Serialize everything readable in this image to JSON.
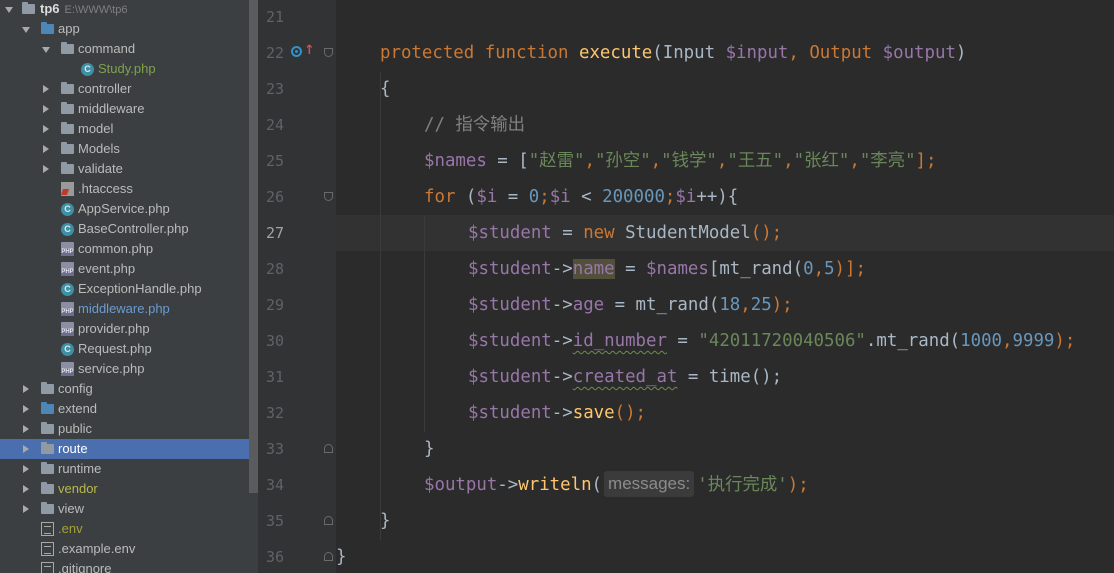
{
  "tree": {
    "project": {
      "name": "tp6",
      "path": "E:\\WWW\\tp6"
    },
    "items": [
      {
        "label": "app",
        "kind": "folder",
        "depth": 1,
        "state": "expanded",
        "color": "#4e86b6"
      },
      {
        "label": "command",
        "kind": "folder",
        "depth": 2,
        "state": "expanded"
      },
      {
        "label": "Study.php",
        "kind": "class-file",
        "depth": 3,
        "text_color": "#80a14f"
      },
      {
        "label": "controller",
        "kind": "folder",
        "depth": 2,
        "state": "collapsed"
      },
      {
        "label": "middleware",
        "kind": "folder",
        "depth": 2,
        "state": "collapsed"
      },
      {
        "label": "model",
        "kind": "folder",
        "depth": 2,
        "state": "collapsed"
      },
      {
        "label": "Models",
        "kind": "folder",
        "depth": 2,
        "state": "collapsed"
      },
      {
        "label": "validate",
        "kind": "folder",
        "depth": 2,
        "state": "collapsed"
      },
      {
        "label": ".htaccess",
        "kind": "htaccess-file",
        "depth": 2
      },
      {
        "label": "AppService.php",
        "kind": "class-file",
        "depth": 2
      },
      {
        "label": "BaseController.php",
        "kind": "class-file",
        "depth": 2
      },
      {
        "label": "common.php",
        "kind": "php-file",
        "depth": 2
      },
      {
        "label": "event.php",
        "kind": "php-file",
        "depth": 2
      },
      {
        "label": "ExceptionHandle.php",
        "kind": "class-file",
        "depth": 2
      },
      {
        "label": "middleware.php",
        "kind": "php-file",
        "depth": 2,
        "text_color": "#6b9bd2"
      },
      {
        "label": "provider.php",
        "kind": "php-file",
        "depth": 2
      },
      {
        "label": "Request.php",
        "kind": "class-file",
        "depth": 2
      },
      {
        "label": "service.php",
        "kind": "php-file",
        "depth": 2
      },
      {
        "label": "config",
        "kind": "folder",
        "depth": 1,
        "state": "collapsed"
      },
      {
        "label": "extend",
        "kind": "folder",
        "depth": 1,
        "state": "collapsed",
        "color": "#4e86b6"
      },
      {
        "label": "public",
        "kind": "folder",
        "depth": 1,
        "state": "collapsed"
      },
      {
        "label": "route",
        "kind": "folder",
        "depth": 1,
        "state": "collapsed",
        "selected": true
      },
      {
        "label": "runtime",
        "kind": "folder",
        "depth": 1,
        "state": "collapsed"
      },
      {
        "label": "vendor",
        "kind": "folder",
        "depth": 1,
        "state": "collapsed",
        "text_color": "#b8b84a"
      },
      {
        "label": "view",
        "kind": "folder",
        "depth": 1,
        "state": "collapsed"
      },
      {
        "label": ".env",
        "kind": "text-file",
        "depth": 1,
        "text_color": "#a5a03a"
      },
      {
        "label": ".example.env",
        "kind": "text-file",
        "depth": 1
      },
      {
        "label": ".gitignore",
        "kind": "text-file",
        "depth": 1
      }
    ]
  },
  "editor": {
    "current_line": "27",
    "line_numbers": [
      "21",
      "22",
      "23",
      "24",
      "25",
      "26",
      "27",
      "28",
      "29",
      "30",
      "31",
      "32",
      "33",
      "34",
      "35",
      "36"
    ],
    "tokens": {
      "l22": {
        "kw1": "protected",
        "kw2": "function",
        "fn": "execute",
        "p1": "(Input ",
        "v1": "$input",
        "p2": ", Output ",
        "v2": "$output",
        "p3": ")"
      },
      "l23": {
        "t": "{"
      },
      "l24": {
        "comment": "// 指令输出"
      },
      "l25": {
        "var": "$names",
        "eq": " = [",
        "s1": "\"赵雷\"",
        "s2": "\"孙空\"",
        "s3": "\"钱学\"",
        "s4": "\"王五\"",
        "s5": "\"张红\"",
        "s6": "\"李亮\"",
        "comma": ",",
        "end": "];"
      },
      "l26": {
        "kw": "for",
        "a": " (",
        "v1": "$i",
        "b": " = ",
        "n1": "0",
        "c": ";",
        "v2": "$i",
        "d": " < ",
        "n2": "200000",
        "e": ";",
        "v3": "$i",
        "f": "++){"
      },
      "l27": {
        "var": "$student",
        "eq": " = ",
        "kw": "new",
        "cls": " StudentModel",
        "end": "();"
      },
      "l28": {
        "var": "$student",
        "arrow": "->",
        "prop": "name",
        "eq": " = ",
        "v2": "$names",
        "a": "[mt_rand(",
        "n1": "0",
        "c": ",",
        "n2": "5",
        "end": ")];"
      },
      "l29": {
        "var": "$student",
        "arrow": "->",
        "prop": "age",
        "eq": " = mt_rand(",
        "n1": "18",
        "c": ",",
        "n2": "25",
        "end": ");"
      },
      "l30": {
        "var": "$student",
        "arrow": "->",
        "prop": "id_number",
        "eq": " = ",
        "str": "\"42011720040506\"",
        "a": ".mt_rand(",
        "n1": "1000",
        "c": ",",
        "n2": "9999",
        "end": ");"
      },
      "l31": {
        "var": "$student",
        "arrow": "->",
        "prop": "created_at",
        "eq": " = time();"
      },
      "l32": {
        "var": "$student",
        "arrow": "->",
        "fn": "save",
        "end": "();"
      },
      "l33": {
        "t": "}"
      },
      "l34": {
        "var": "$output",
        "arrow": "->",
        "fn": "writeln",
        "a": "(",
        "hint": "messages:",
        "str": "'执行完成'",
        "end": ");"
      },
      "l35": {
        "t": "}"
      },
      "l36": {
        "t": "}"
      }
    }
  },
  "colors": {
    "keyword": "#cc7832",
    "function": "#ffc66d",
    "variable": "#9876aa",
    "number": "#6897bb",
    "string": "#6a8759",
    "comment": "#808080",
    "text": "#a9b7c6",
    "selection": "#4b6eaf"
  }
}
